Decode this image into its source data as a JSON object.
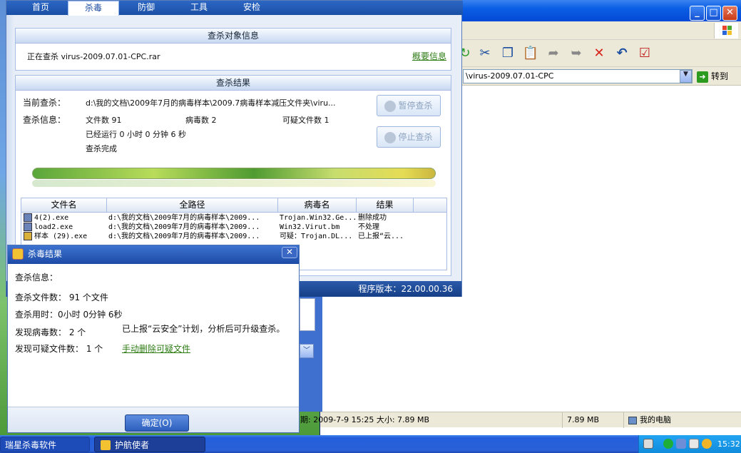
{
  "rising": {
    "tabs": [
      {
        "label": "首页"
      },
      {
        "label": "杀毒"
      },
      {
        "label": "防御"
      },
      {
        "label": "工具"
      },
      {
        "label": "安检"
      }
    ],
    "target_section": {
      "title": "查杀对象信息",
      "scanning_text": "正在查杀 virus-2009.07.01-CPC.rar",
      "summary_link": "概要信息"
    },
    "result_section": {
      "title": "查杀结果",
      "current_label": "当前查杀：",
      "current_path": "d:\\我的文档\\2009年7月的病毒样本\\2009.7病毒样本减压文件夹\\viru...",
      "info_label": "查杀信息：",
      "file_count": "文件数 91",
      "virus_count": "病毒数 2",
      "suspicious_count": "可疑文件数 1",
      "running_time": "已经运行 0 小时 0 分钟 6  秒",
      "status": "查杀完成",
      "pause_button": "暂停查杀",
      "stop_button": "停止查杀"
    },
    "table": {
      "columns": [
        "文件名",
        "全路径",
        "病毒名",
        "结果"
      ],
      "rows": [
        {
          "file": "4(2).exe",
          "path": "d:\\我的文档\\2009年7月的病毒样本\\2009...",
          "virus": "Trojan.Win32.Ge...",
          "result": "删除成功"
        },
        {
          "file": "load2.exe",
          "path": "d:\\我的文档\\2009年7月的病毒样本\\2009...",
          "virus": "Win32.Virut.bm",
          "result": "不处理"
        },
        {
          "file": "样本 (29).exe",
          "path": "d:\\我的文档\\2009年7月的病毒样本\\2009...",
          "virus": "可疑：Trojan.DL...",
          "result": "已上报“云..."
        }
      ]
    },
    "version": "程序版本：22.00.00.36"
  },
  "dialog": {
    "title": "杀毒结果",
    "info_label": "查杀信息：",
    "files_scanned": "查杀文件数： 91 个文件",
    "time_used": "查杀用时：0小时 0分钟 6秒",
    "viruses_found": "发现病毒数：  2 个",
    "suspicious_found": "发现可疑文件数：  1 个",
    "cloud_message": "已上报“云安全”计划，分析后可升级查杀。",
    "manual_delete_link": "手动删除可疑文件",
    "ok_button": "确定(O)",
    "close_glyph": "✕"
  },
  "explorer": {
    "address": "\\virus-2009.07.01-CPC",
    "go_label": "转到",
    "status_modified": "期: 2009-7-9 15:25 大小: 7.89 MB",
    "status_size": "7.89 MB",
    "status_location": "我的电脑",
    "window_buttons": [
      "_",
      "□",
      "✕"
    ]
  },
  "taskbar": {
    "tasks": [
      {
        "label": "瑞星杀毒软件"
      },
      {
        "label": "护航使者"
      }
    ],
    "clock": "15:32"
  },
  "colors": {
    "xp_blue": "#245edb",
    "link_green": "#2e7c14",
    "rising_blue": "#1c4ba6"
  }
}
